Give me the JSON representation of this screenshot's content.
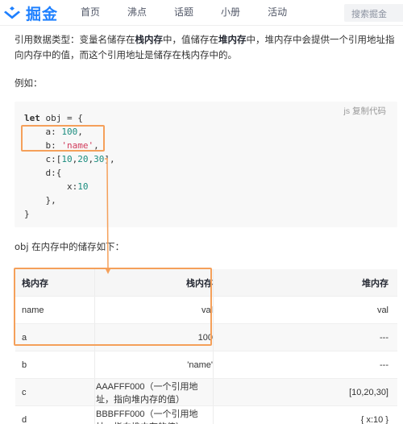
{
  "header": {
    "logo_text": "掘金",
    "nav": [
      "首页",
      "沸点",
      "话题",
      "小册",
      "活动"
    ],
    "search_placeholder": "搜索掘金",
    "brand_color": "#1e80ff"
  },
  "article": {
    "p1_a": "引用数据类型：变量名储存在",
    "p1_b1": "栈内存",
    "p1_c": "中，值储存在",
    "p1_b2": "堆内存",
    "p1_d": "中，堆内存中会提供一个引用地址指向内存中的值，而这个引用地址是储存在栈内存中的。",
    "example_label": "例如：",
    "table_intro": "obj 在内存中的储存如下："
  },
  "code": {
    "language_label": "js 复制代码",
    "line1_kw": "let",
    "line1_rest": " obj = {",
    "line2_key": "    a: ",
    "line2_val": "100",
    "line2_end": ",",
    "line3_key": "    b: ",
    "line3_val": "'name'",
    "line3_end": ",",
    "line4_a": "    c:[",
    "line4_v1": "10",
    "line4_s1": ",",
    "line4_v2": "20",
    "line4_s2": ",",
    "line4_v3": "30",
    "line4_end": "],",
    "line5": "    d:{",
    "line6_a": "        x:",
    "line6_v": "10",
    "line7": "    },",
    "line8": "}"
  },
  "table": {
    "headers": [
      "栈内存",
      "栈内存",
      "堆内存"
    ],
    "rows": [
      [
        "name",
        "val",
        "val"
      ],
      [
        "a",
        "100",
        "---"
      ],
      [
        "b",
        "'name'",
        "---"
      ],
      [
        "c",
        "AAAFFF000（一个引用地址，指向堆内存的值）",
        "[10,20,30]"
      ],
      [
        "d",
        "BBBFFF000（一个引用地址，指向堆内存的值）",
        "{ x:10 }"
      ]
    ]
  },
  "annotation": {
    "highlight_color": "#f5a05a"
  }
}
